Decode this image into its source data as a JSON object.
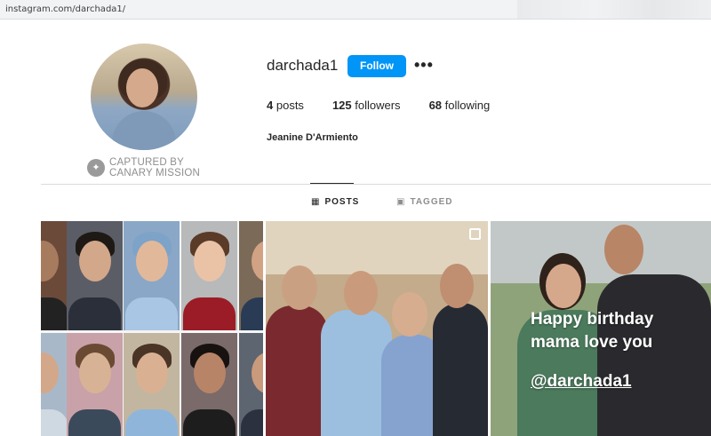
{
  "browser": {
    "url": "instagram.com/darchada1/"
  },
  "profile": {
    "username": "darchada1",
    "follow_label": "Follow",
    "more_label": "•••",
    "stats": [
      {
        "count": "4",
        "label": "posts"
      },
      {
        "count": "125",
        "label": "followers"
      },
      {
        "count": "68",
        "label": "following"
      }
    ],
    "full_name": "Jeanine D'Armiento",
    "watermark": {
      "line1": "CAPTURED BY",
      "line2": "CANARY MISSION"
    }
  },
  "tabs": [
    {
      "label": "POSTS",
      "icon": "grid-icon",
      "active": true
    },
    {
      "label": "TAGGED",
      "icon": "tag-icon",
      "active": false
    }
  ],
  "posts": {
    "story": {
      "line1": "Happy birthday",
      "line2": "mama love you",
      "mention": "@darchada1"
    }
  },
  "colors": {
    "accent": "#0095f6",
    "text": "#262626",
    "muted": "#8e8e8e",
    "divider": "#dbdbdb"
  }
}
